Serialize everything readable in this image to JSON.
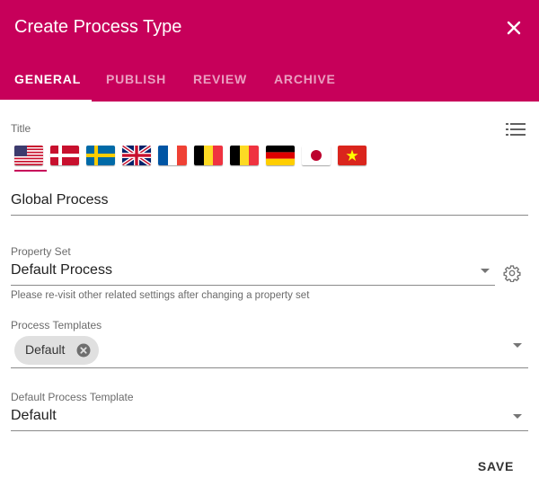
{
  "dialog": {
    "title": "Create Process Type"
  },
  "tabs": [
    {
      "label": "GENERAL",
      "active": true
    },
    {
      "label": "PUBLISH",
      "active": false
    },
    {
      "label": "REVIEW",
      "active": false
    },
    {
      "label": "ARCHIVE",
      "active": false
    }
  ],
  "title_field": {
    "label": "Title",
    "value": "Global Process",
    "languages": [
      "us",
      "dk",
      "se",
      "gb",
      "fr",
      "be",
      "de",
      "jp",
      "vn"
    ],
    "selected_language": "us"
  },
  "property_set": {
    "label": "Property Set",
    "value": "Default Process",
    "hint": "Please re-visit other related settings after changing a property set"
  },
  "process_templates": {
    "label": "Process Templates",
    "chips": [
      "Default"
    ]
  },
  "default_process_template": {
    "label": "Default Process Template",
    "value": "Default"
  },
  "actions": {
    "save_label": "SAVE"
  },
  "colors": {
    "primary": "#c7005a",
    "header_text": "#ffffff"
  },
  "icons": {
    "close": "close-icon",
    "list": "list-icon",
    "settings": "gear-icon",
    "chip_remove": "cancel-circle-icon",
    "dropdown": "arrow-down-icon"
  }
}
